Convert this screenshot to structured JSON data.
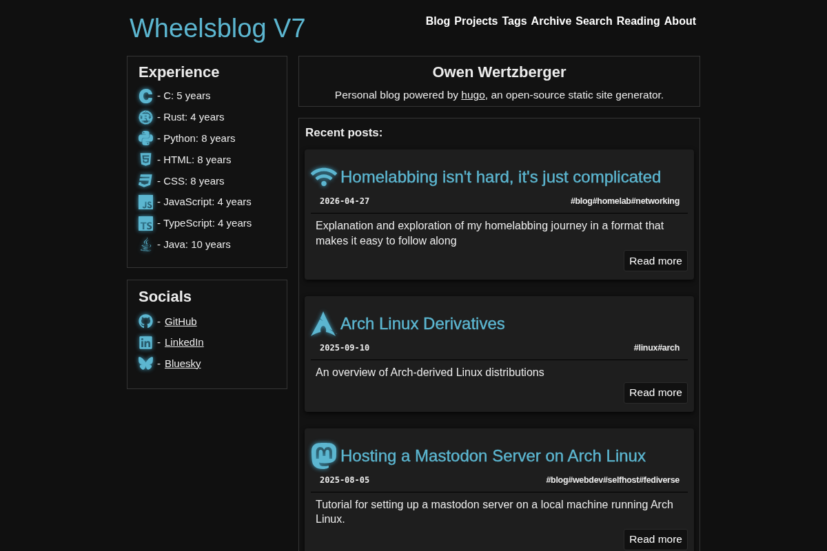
{
  "header": {
    "site_title": "Wheelsblog V7",
    "nav": [
      "Blog",
      "Projects",
      "Tags",
      "Archive",
      "Search",
      "Reading",
      "About"
    ]
  },
  "sidebar": {
    "experience": {
      "heading": "Experience",
      "items": [
        "- C: 5 years",
        "- Rust: 4 years",
        "- Python: 8 years",
        "- HTML: 8 years",
        "- CSS: 8 years",
        "- JavaScript: 4 years",
        "- TypeScript: 4 years",
        "- Java: 10 years"
      ]
    },
    "socials": {
      "heading": "Socials",
      "items": [
        {
          "prefix": "-",
          "link": "GitHub"
        },
        {
          "prefix": "-",
          "link": "LinkedIn"
        },
        {
          "prefix": "-",
          "link": "Bluesky"
        }
      ]
    }
  },
  "profile": {
    "name": "Owen Wertzberger",
    "description": {
      "before": "Personal blog powered by",
      "link": "hugo",
      "after": ", an open-source static site generator."
    }
  },
  "recent_posts": {
    "heading": "Recent posts:",
    "posts": [
      {
        "title": "Homelabbing isn't hard, it's just complicated",
        "date": "2026-04-27",
        "tags": [
          "#blog",
          "#homelab",
          "#networking"
        ],
        "summary": "Explanation and exploration of my homelabbing journey in a format that makes it easy to follow along",
        "button": "Read more"
      },
      {
        "title": "Arch Linux Derivatives",
        "date": "2025-09-10",
        "tags": [
          "#linux",
          "#arch"
        ],
        "summary": "An overview of Arch-derived Linux distributions",
        "button": "Read more"
      },
      {
        "title": "Hosting a Mastodon Server on Arch Linux",
        "date": "2025-08-05",
        "tags": [
          "#blog",
          "#webdev",
          "#selfhost",
          "#fediverse"
        ],
        "summary": "Tutorial for setting up a mastodon server on a local machine running Arch Linux.",
        "button": "Read more"
      }
    ]
  }
}
